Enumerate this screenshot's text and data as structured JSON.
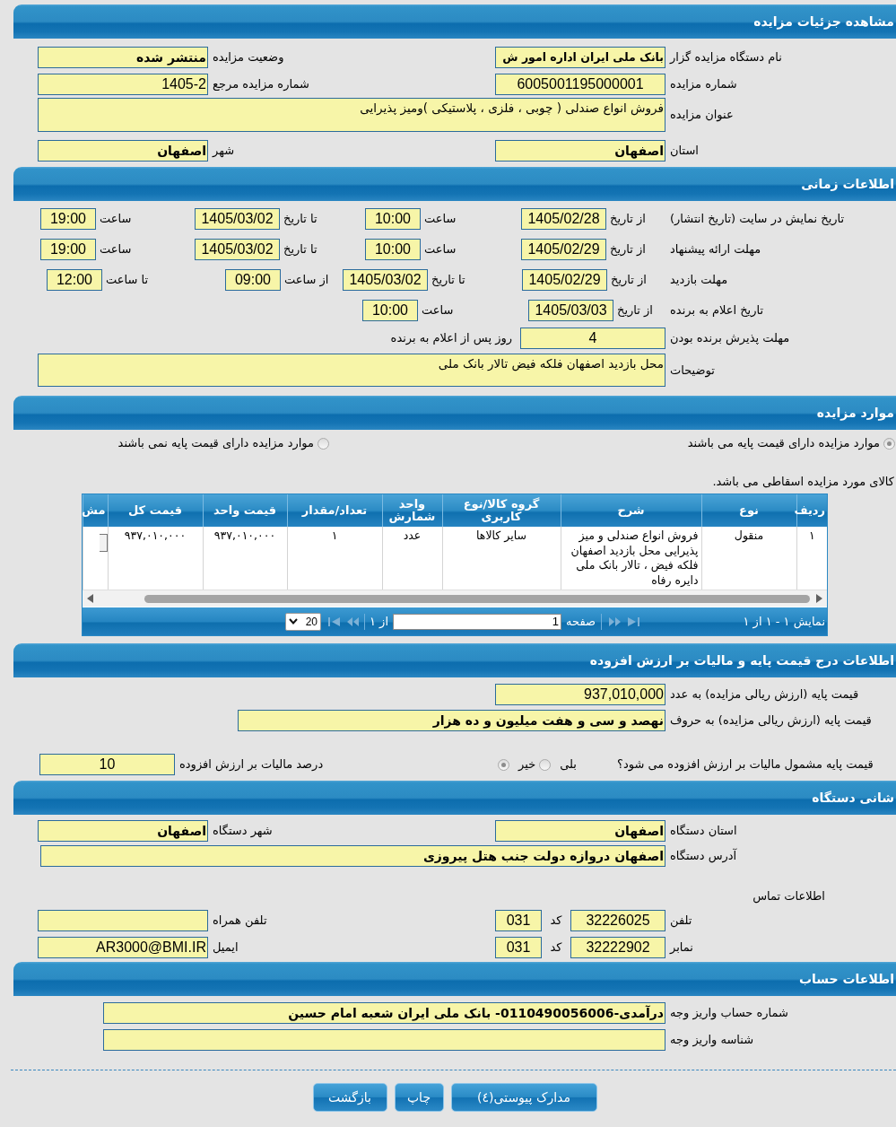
{
  "details": {
    "title": "مشاهده جزئیات مزایده",
    "organizer": {
      "label": "نام دستگاه مزایده گزار",
      "value": "بانک ملی ایران اداره امور ش"
    },
    "status": {
      "label": "وضعیت مزایده",
      "value": "منتشر شده"
    },
    "auction_number": {
      "label": "شماره مزایده",
      "value": "6005001195000001"
    },
    "reference_number": {
      "label": "شماره مزایده مرجع",
      "value": "1405-2"
    },
    "subject": {
      "label": "عنوان مزایده",
      "value": "فروش انواع صندلی ( چوبی ، فلزی ، پلاستیکی )ومیز پذیرایی"
    },
    "province": {
      "label": "استان",
      "value": "اصفهان"
    },
    "city": {
      "label": "شهر",
      "value": "اصفهان"
    }
  },
  "timing": {
    "title": "اطلاعات زمانی",
    "rows": [
      {
        "label": "تاریخ نمایش در سایت (تاریخ انتشار)",
        "parts": [
          {
            "kind": "date",
            "label": "از تاریخ",
            "value": "1405/02/28"
          },
          {
            "kind": "time",
            "label": "ساعت",
            "value": "10:00"
          },
          {
            "kind": "date",
            "label": "تا تاریخ",
            "value": "1405/03/02"
          },
          {
            "kind": "time",
            "label": "ساعت",
            "value": "19:00"
          }
        ]
      },
      {
        "label": "مهلت ارائه پیشنهاد",
        "parts": [
          {
            "kind": "date",
            "label": "از تاریخ",
            "value": "1405/02/29"
          },
          {
            "kind": "time",
            "label": "ساعت",
            "value": "10:00"
          },
          {
            "kind": "date",
            "label": "تا تاریخ",
            "value": "1405/03/02"
          },
          {
            "kind": "time",
            "label": "ساعت",
            "value": "19:00"
          }
        ]
      },
      {
        "label": "مهلت بازدید",
        "parts": [
          {
            "kind": "date",
            "label": "از تاریخ",
            "value": "1405/02/29"
          },
          {
            "kind": "date",
            "label": "تا تاریخ",
            "value": "1405/03/02"
          },
          {
            "kind": "time",
            "label": "از ساعت",
            "value": "09:00"
          },
          {
            "kind": "time",
            "label": "تا ساعت",
            "value": "12:00"
          }
        ]
      },
      {
        "label": "تاریخ اعلام به برنده",
        "parts": [
          {
            "kind": "date",
            "label": "از تاریخ",
            "value": "1405/03/03"
          },
          {
            "kind": "time",
            "label": "ساعت",
            "value": "10:00"
          }
        ]
      }
    ],
    "acceptance": {
      "label": "مهلت پذیرش برنده بودن",
      "value": "4",
      "suffix": "روز پس از اعلام به برنده"
    },
    "notes": {
      "label": "توضیحات",
      "value": "محل بازدید اصفهان فلکه فیض تالار بانک ملی"
    }
  },
  "items": {
    "title": "موارد مزایده",
    "options": [
      {
        "label": "موارد مزایده دارای قیمت پایه می باشند",
        "selected": true
      },
      {
        "label": "موارد مزایده دارای قیمت پایه نمی باشند",
        "selected": false
      }
    ],
    "note": "کالای مورد مزایده اسقاطی می باشد.",
    "table": {
      "columns": [
        "ردیف",
        "نوع",
        "شرح",
        "گروه کالا/نوع کاربری",
        "واحد شمارش",
        "تعداد/مقدار",
        "قیمت واحد",
        "قیمت کل",
        "مش"
      ],
      "rows": [
        [
          "۱",
          "منقول",
          "فروش انواع صندلی و میز پذیرایی محل بازدید اصفهان فلکه فیض ، تالار بانک ملی دایره رفاه",
          "سایر کالاها",
          "عدد",
          "۱",
          "۹۳۷,۰۱۰,۰۰۰",
          "۹۳۷,۰۱۰,۰۰۰"
        ]
      ]
    },
    "pager": {
      "summary": "نمایش ۱ - ۱ از ۱",
      "nav": [
        {
          "kind": "first",
          "disabled": true
        },
        {
          "kind": "prev",
          "disabled": true
        },
        {
          "kind": "next",
          "disabled": true
        },
        {
          "kind": "last",
          "disabled": true
        }
      ],
      "page_label": "صفحه",
      "page": "1",
      "page_total": "از ۱",
      "page_size": "20"
    }
  },
  "pricing": {
    "title": "اطلاعات درج قیمت پایه و مالیات بر ارزش افزوده",
    "amount": {
      "label": "قیمت پایه (ارزش ریالی مزایده) به عدد",
      "value": "937,010,000"
    },
    "amount_words": {
      "label": "قیمت پایه (ارزش ریالی مزایده) به حروف",
      "value": "نهصد و سی و هفت میلیون و ده هزار"
    },
    "vat_question": {
      "label": "قیمت پایه مشمول مالیات بر ارزش افزوده می شود؟",
      "options": [
        {
          "label": "بلی",
          "selected": false
        },
        {
          "label": "خیر",
          "selected": true
        }
      ]
    },
    "vat_percent": {
      "label": "درصد مالیات بر ارزش افزوده",
      "value": "10"
    }
  },
  "address": {
    "title": "شانی دستگاه",
    "province": {
      "label": "استان دستگاه",
      "value": "اصفهان"
    },
    "city": {
      "label": "شهر دستگاه",
      "value": "اصفهان"
    },
    "address": {
      "label": "آدرس دستگاه",
      "value": "اصفهان دروازه دولت جنب هتل پیروزی"
    },
    "contact_heading": "اطلاعات تماس",
    "phone": {
      "label": "تلفن",
      "value": "32226025",
      "code_label": "کد",
      "code": "031"
    },
    "mobile": {
      "label": "تلفن همراه"
    },
    "fax": {
      "label": "نمابر",
      "value": "32222902",
      "code_label": "کد",
      "code": "031"
    },
    "email": {
      "label": "ایمیل",
      "value": "AR3000@BMI.IR"
    }
  },
  "account": {
    "title": "اطلاعات حساب",
    "account_number": {
      "label": "شماره حساب واریز وجه",
      "value": "درآمدی-0110490056006- بانک ملی ایران شعبه امام حسین"
    },
    "payment_id": {
      "label": "شناسه واریز وجه"
    }
  },
  "buttons": [
    "مدارک پیوستی(٤)",
    "چاپ",
    "بازگشت"
  ]
}
